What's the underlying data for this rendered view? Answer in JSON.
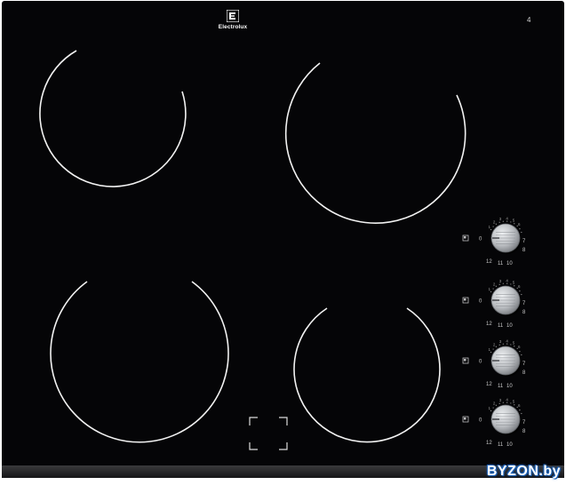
{
  "brand": {
    "name": "Electrolux"
  },
  "rating_mark": "4",
  "knob_scale": {
    "off": "0",
    "right_labels": [
      "7",
      "8"
    ],
    "bottom_labels": [
      "12",
      "11",
      "10"
    ],
    "top_labels": [
      "1",
      "2",
      "3",
      "4",
      "5",
      "6"
    ],
    "knob_count": 4
  },
  "watermark": "BYZON.by",
  "colors": {
    "glass": "#050507",
    "frame": "#2a2a2c",
    "ring": "#f5f5f5",
    "knob": "#b9bcc0",
    "watermark": "#1a5fb4"
  },
  "icons": {
    "logo": "electrolux-logo-icon",
    "zone_indicator": "zone-indicator-icon",
    "bridge_zone": "bridge-zone-marker-icon"
  }
}
